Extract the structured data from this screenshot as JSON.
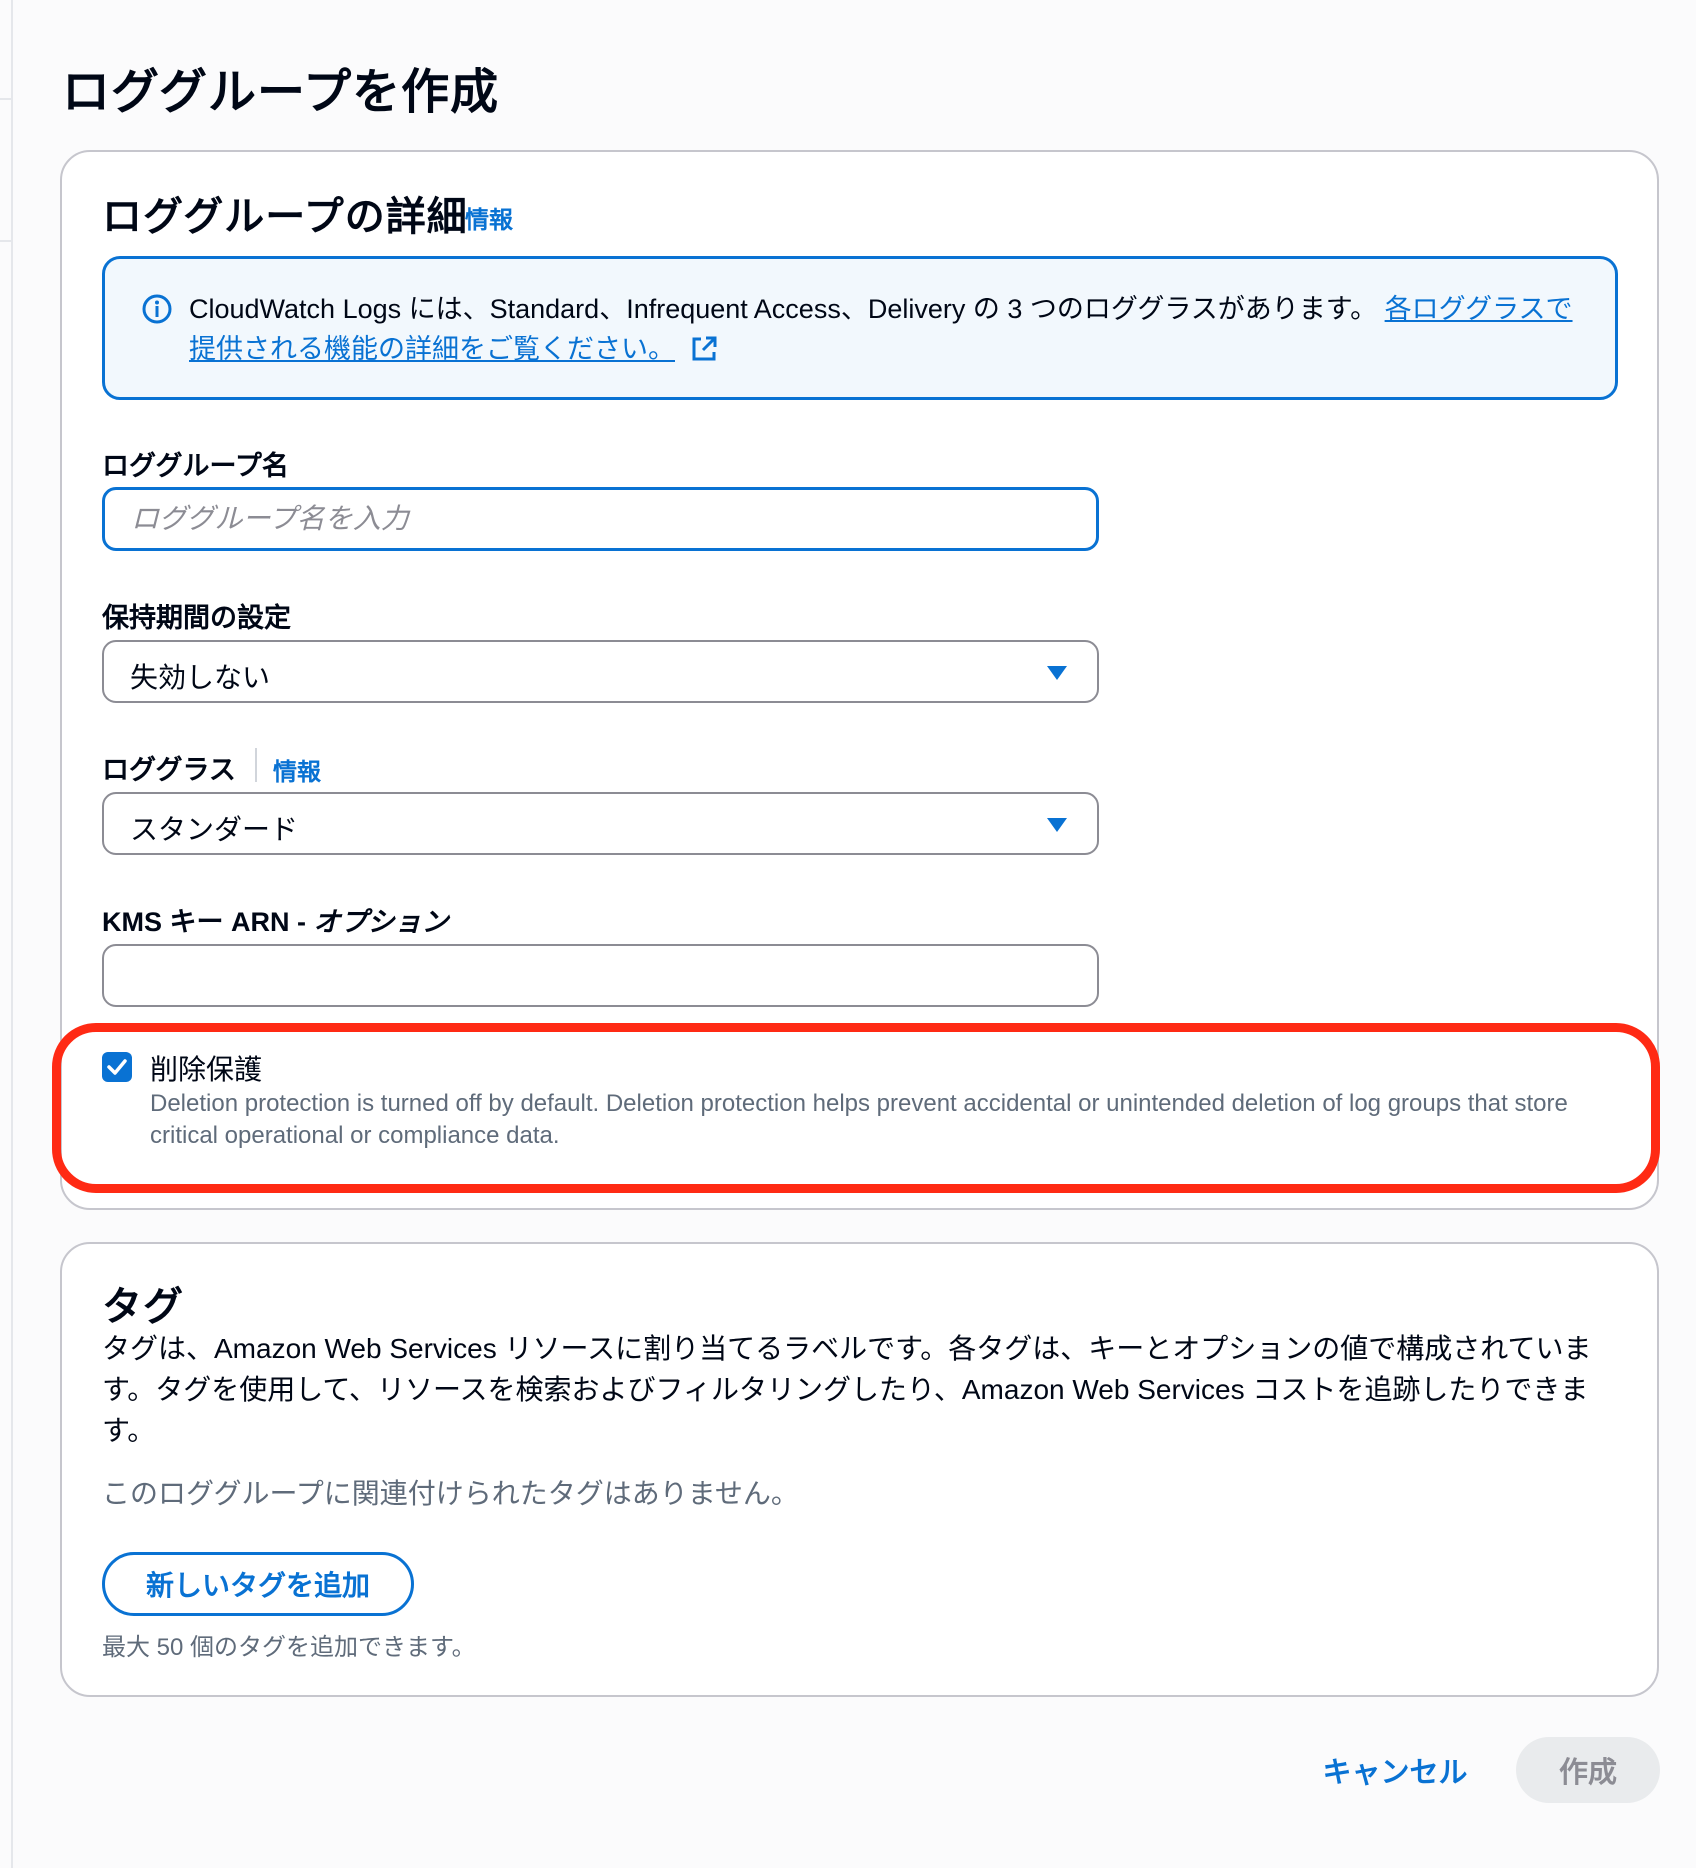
{
  "page": {
    "title": "ロググループを作成"
  },
  "details": {
    "title": "ロググループの詳細",
    "info_label": "情報",
    "alert": {
      "icon": "info-circle-icon",
      "text": "CloudWatch Logs には、Standard、Infrequent Access、Delivery の 3 つのロググラスがあります。",
      "link_text": "各ロググラスで提供される機能の詳細をご覧ください。",
      "link_icon": "external-link-icon"
    },
    "log_group_name": {
      "label": "ロググループ名",
      "placeholder": "ロググループ名を入力",
      "value": ""
    },
    "retention": {
      "label": "保持期間の設定",
      "value": "失効しない"
    },
    "log_class": {
      "label": "ロググラス",
      "info_label": "情報",
      "value": "スタンダード"
    },
    "kms": {
      "label": "KMS キー ARN - ",
      "label_optional": "オプション",
      "value": ""
    },
    "deletion_protection": {
      "label": "削除保護",
      "checked": true,
      "description": "Deletion protection is turned off by default. Deletion protection helps prevent accidental or unintended deletion of log groups that store critical operational or compliance data."
    }
  },
  "tags": {
    "title": "タグ",
    "description": "タグは、Amazon Web Services リソースに割り当てるラベルです。各タグは、キーとオプションの値で構成されています。タグを使用して、リソースを検索およびフィルタリングしたり、Amazon Web Services コストを追跡したりできます。",
    "empty_text": "このロググループに関連付けられたタグはありません。",
    "add_button": "新しいタグを追加",
    "hint": "最大 50 個のタグを追加できます。"
  },
  "footer": {
    "cancel_label": "キャンセル",
    "create_label": "作成"
  },
  "colors": {
    "accent": "#0972d3",
    "highlight": "#ff2a14",
    "muted": "#5f6b7a"
  }
}
